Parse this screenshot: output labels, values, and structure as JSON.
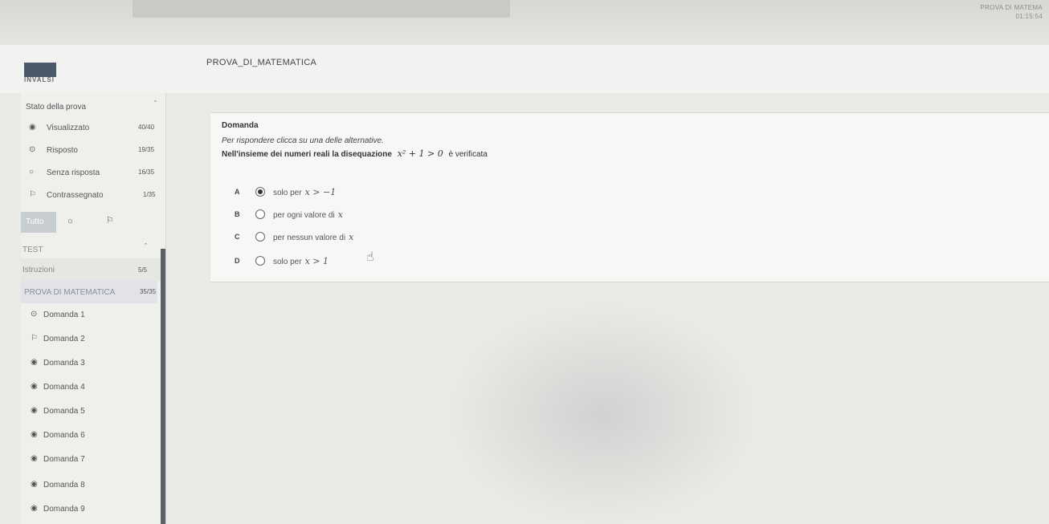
{
  "timer": {
    "label": "PROVA DI MATEMA",
    "time": "01:15:54"
  },
  "app": {
    "logo_text": "INVALSI",
    "title": "PROVA_DI_MATEMATICA"
  },
  "sidebar": {
    "state_title": "Stato della prova",
    "stats": [
      {
        "icon": "eye-icon",
        "glyph": "◉",
        "label": "Visualizzato",
        "count": "40/40"
      },
      {
        "icon": "radio-dot-icon",
        "glyph": "⊙",
        "label": "Risposto",
        "count": "19/35"
      },
      {
        "icon": "empty-circle-icon",
        "glyph": "○",
        "label": "Senza risposta",
        "count": "16/35"
      },
      {
        "icon": "flag-icon",
        "glyph": "⚐",
        "label": "Contrassegnato",
        "count": "1/35"
      }
    ],
    "filter": {
      "all_label": "Tutto",
      "circle_glyph": "○",
      "flag_glyph": "⚐"
    },
    "test_title": "TEST",
    "istruzioni": {
      "label": "Istruzioni",
      "count": "5/5"
    },
    "prova": {
      "label": "PROVA DI MATEMATICA",
      "count": "35/35"
    },
    "questions": [
      {
        "label": "Domanda 1",
        "glyph": "⊙"
      },
      {
        "label": "Domanda 2",
        "glyph": "⚐"
      },
      {
        "label": "Domanda 3",
        "glyph": "◉"
      },
      {
        "label": "Domanda 4",
        "glyph": "◉"
      },
      {
        "label": "Domanda 5",
        "glyph": "◉"
      },
      {
        "label": "Domanda 6",
        "glyph": "◉"
      },
      {
        "label": "Domanda 7",
        "glyph": "◉"
      },
      {
        "label": "Domanda 8",
        "glyph": "◉"
      },
      {
        "label": "Domanda 9",
        "glyph": "◉"
      }
    ]
  },
  "question": {
    "title": "Domanda",
    "instruction": "Per rispondere clicca su una delle alternative.",
    "text_prefix": "Nell'insieme dei numeri reali la disequazione",
    "math": "x² + 1 > 0",
    "text_suffix": "è verificata",
    "options": [
      {
        "letter": "A",
        "text": "solo per",
        "math": "x > −1",
        "selected": true
      },
      {
        "letter": "B",
        "text": "per ogni valore di",
        "math": "x",
        "selected": false
      },
      {
        "letter": "C",
        "text": "per nessun valore di",
        "math": "x",
        "selected": false
      },
      {
        "letter": "D",
        "text": "solo per",
        "math": "x > 1",
        "selected": false
      }
    ]
  }
}
